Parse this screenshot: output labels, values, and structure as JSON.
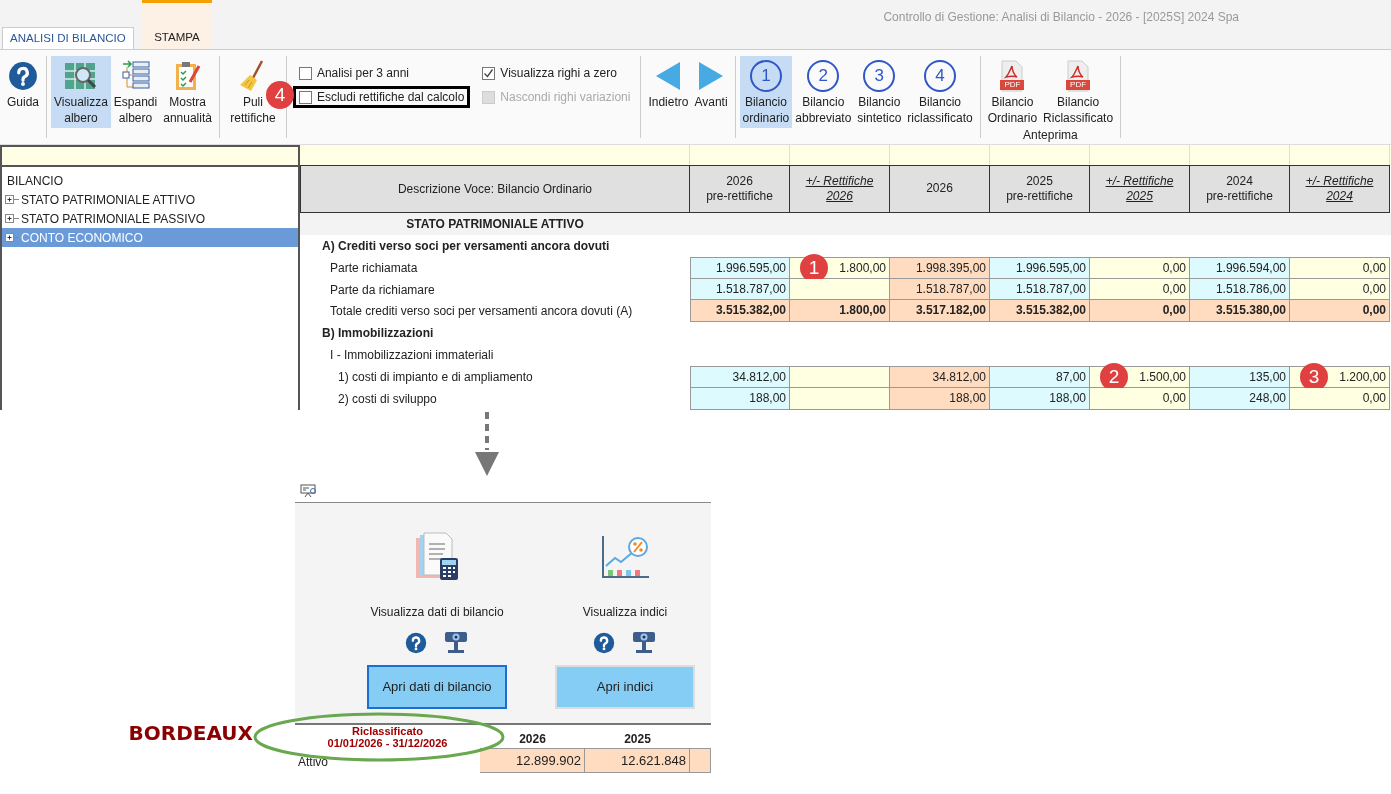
{
  "window": {
    "title": "Controllo di Gestione: Analisi di Bilancio - 2026 - [2025S] 2024 Spa"
  },
  "tabs": [
    {
      "label": "ANALISI DI BILANCIO",
      "selected": true,
      "contextual": false
    },
    {
      "label": "STAMPA",
      "selected": false,
      "contextual": true
    }
  ],
  "ribbon": [
    {
      "kind": "tools",
      "items": [
        {
          "kind": "help",
          "lines": [
            "Guida"
          ],
          "selected": false
        }
      ]
    },
    {
      "kind": "tools",
      "items": [
        {
          "kind": "grid",
          "lines": [
            "Visualizza",
            "albero"
          ],
          "selected": true
        },
        {
          "kind": "list",
          "lines": [
            "Espandi",
            "albero"
          ],
          "selected": false
        },
        {
          "kind": "clipboard",
          "lines": [
            "Mostra",
            "annualità"
          ],
          "selected": false
        }
      ]
    },
    {
      "kind": "tools",
      "items": [
        {
          "kind": "broom",
          "lines": [
            "Puli",
            "rettifiche"
          ],
          "selected": false
        }
      ]
    },
    {
      "kind": "checks",
      "columns": [
        [
          {
            "label": "Analisi per 3 anni",
            "checked": false,
            "disabled": false
          },
          {
            "label": "Escludi rettifiche dal calcolo",
            "checked": false,
            "disabled": false,
            "boxed": true,
            "marker": "4"
          }
        ],
        [
          {
            "label": "Visualizza righi a zero",
            "checked": true,
            "disabled": false
          },
          {
            "label": "Nascondi righi variazioni",
            "checked": false,
            "disabled": true
          }
        ]
      ]
    },
    {
      "kind": "tools",
      "items": [
        {
          "kind": "back",
          "lines": [
            "Indietro"
          ],
          "selected": false
        },
        {
          "kind": "forward",
          "lines": [
            "Avanti"
          ],
          "selected": false
        }
      ]
    },
    {
      "kind": "tools",
      "items": [
        {
          "kind": "step",
          "number": "1",
          "lines": [
            "Bilancio",
            "ordinario"
          ],
          "selected": true
        },
        {
          "kind": "step",
          "number": "2",
          "lines": [
            "Bilancio",
            "abbreviato"
          ],
          "selected": false
        },
        {
          "kind": "step",
          "number": "3",
          "lines": [
            "Bilancio",
            "sintetico"
          ],
          "selected": false
        },
        {
          "kind": "step",
          "number": "4",
          "lines": [
            "Bilancio",
            "riclassificato"
          ],
          "selected": false
        }
      ]
    },
    {
      "kind": "tools",
      "label": "Anteprima",
      "items": [
        {
          "kind": "pdf",
          "badge_text": "PDF",
          "lines": [
            "Bilancio",
            "Ordinario"
          ],
          "selected": false
        },
        {
          "kind": "pdf",
          "badge_text": "PDF",
          "lines": [
            "Bilancio",
            "Riclassificato"
          ],
          "selected": false
        }
      ]
    }
  ],
  "tree": {
    "root": "BILANCIO",
    "items": [
      {
        "label": "STATO PATRIMONIALE ATTIVO",
        "selected": false
      },
      {
        "label": "STATO PATRIMONIALE PASSIVO",
        "selected": false
      },
      {
        "label": "CONTO ECONOMICO",
        "selected": true
      }
    ]
  },
  "table": {
    "description_header": "Descrizione Voce: Bilancio Ordinario",
    "columns": [
      {
        "lines": [
          "2026",
          "pre-rettifiche"
        ],
        "kind": "pre"
      },
      {
        "lines": [
          "+/- Rettifiche",
          "2026"
        ],
        "kind": "rett"
      },
      {
        "lines": [
          "2026"
        ],
        "kind": "main"
      },
      {
        "lines": [
          "2025",
          "pre-rettifiche"
        ],
        "kind": "pre"
      },
      {
        "lines": [
          "+/- Rettifiche",
          "2025"
        ],
        "kind": "rett"
      },
      {
        "lines": [
          "2024",
          "pre-rettifiche"
        ],
        "kind": "pre"
      },
      {
        "lines": [
          "+/- Rettifiche",
          "2024"
        ],
        "kind": "rett"
      }
    ],
    "rows": [
      {
        "kind": "section",
        "label": "STATO PATRIMONIALE ATTIVO"
      },
      {
        "kind": "group",
        "label": "A) Crediti verso soci per versamenti ancora dovuti"
      },
      {
        "kind": "item",
        "label": "Parte richiamata",
        "cells": [
          {
            "value": "1.996.595,00"
          },
          {
            "value": "1.800,00",
            "marker": "1"
          },
          {
            "value": "1.998.395,00"
          },
          {
            "value": "1.996.595,00"
          },
          {
            "value": "0,00"
          },
          {
            "value": "1.996.594,00"
          },
          {
            "value": "0,00"
          }
        ]
      },
      {
        "kind": "item",
        "label": "Parte da richiamare",
        "cells": [
          {
            "value": "1.518.787,00"
          },
          {},
          {
            "value": "1.518.787,00"
          },
          {
            "value": "1.518.787,00"
          },
          {
            "value": "0,00"
          },
          {
            "value": "1.518.786,00"
          },
          {
            "value": "0,00"
          }
        ]
      },
      {
        "kind": "total",
        "label": "Totale crediti verso soci per versamenti ancora dovuti (A)",
        "cells": [
          {
            "value": "3.515.382,00"
          },
          {
            "value": "1.800,00"
          },
          {
            "value": "3.517.182,00"
          },
          {
            "value": "3.515.382,00"
          },
          {
            "value": "0,00"
          },
          {
            "value": "3.515.380,00"
          },
          {
            "value": "0,00"
          }
        ]
      },
      {
        "kind": "group",
        "label": "B) Immobilizzazioni"
      },
      {
        "kind": "subgroup",
        "label": "I - Immobilizzazioni immateriali"
      },
      {
        "kind": "subitem",
        "label": "1) costi di impianto e di ampliamento",
        "cells": [
          {
            "value": "34.812,00"
          },
          {},
          {
            "value": "34.812,00"
          },
          {
            "value": "87,00"
          },
          {
            "value": "1.500,00",
            "marker": "2"
          },
          {
            "value": "135,00"
          },
          {
            "value": "1.200,00",
            "marker": "3"
          }
        ]
      },
      {
        "kind": "subitem",
        "label": "2) costi di sviluppo",
        "cells": [
          {
            "value": "188,00"
          },
          {},
          {
            "value": "188,00"
          },
          {
            "value": "188,00"
          },
          {
            "value": "0,00"
          },
          {
            "value": "248,00"
          },
          {
            "value": "0,00"
          }
        ]
      }
    ]
  },
  "panel": {
    "cards": [
      {
        "title": "Visualizza dati di bilancio",
        "button": "Apri dati di bilancio",
        "focused": true
      },
      {
        "title": "Visualizza indici",
        "button": "Apri indici",
        "focused": false
      }
    ],
    "table": {
      "header_lines": [
        "Riclassificato",
        "01/01/2026 - 31/12/2026"
      ],
      "columns": [
        "2026",
        "2025"
      ],
      "rows": [
        {
          "label": "Attivo",
          "values": [
            "12.899.902",
            "12.621.848"
          ]
        }
      ]
    }
  },
  "annotation": {
    "label": "BORDEAUX"
  }
}
